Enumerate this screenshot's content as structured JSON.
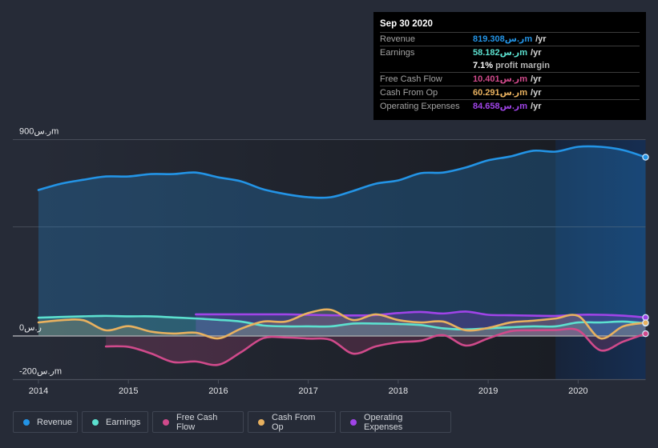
{
  "tooltip": {
    "date": "Sep 30 2020",
    "rows": [
      {
        "label": "Revenue",
        "value": "ر.س819.308m",
        "suffix": "/yr",
        "color": "#2394e6"
      },
      {
        "label": "Earnings",
        "value": "ر.س58.182m",
        "suffix": "/yr",
        "color": "#5ce0cf"
      },
      {
        "label": "Free Cash Flow",
        "value": "ر.س10.401m",
        "suffix": "/yr",
        "color": "#d04a8b"
      },
      {
        "label": "Cash From Op",
        "value": "ر.س60.291m",
        "suffix": "/yr",
        "color": "#e8b15f"
      },
      {
        "label": "Operating Expenses",
        "value": "ر.س84.658m",
        "suffix": "/yr",
        "color": "#a044e8"
      }
    ],
    "profit_margin": {
      "value": "7.1%",
      "label": "profit margin"
    }
  },
  "legend": {
    "items": [
      {
        "label": "Revenue",
        "color": "#2394e6"
      },
      {
        "label": "Earnings",
        "color": "#5ce0cf"
      },
      {
        "label": "Free Cash Flow",
        "color": "#d04a8b"
      },
      {
        "label": "Cash From Op",
        "color": "#e8b15f"
      },
      {
        "label": "Operating Expenses",
        "color": "#a044e8"
      }
    ]
  },
  "chart_data": {
    "type": "area",
    "title": "",
    "xlabel": "",
    "ylabel": "",
    "xlim": [
      2014,
      2020.75
    ],
    "ylim": [
      -200,
      900
    ],
    "grid": true,
    "y_gridlines": [
      900,
      500
    ],
    "y_tick_labels": [
      {
        "value": 900,
        "label": "ر.س900m"
      },
      {
        "value": 0,
        "label": "ر.س0"
      },
      {
        "value": -200,
        "label": "-ر.س200m"
      }
    ],
    "x_ticks": [
      2014,
      2015,
      2016,
      2017,
      2018,
      2019,
      2020
    ],
    "x_tick_labels": [
      "2014",
      "2015",
      "2016",
      "2017",
      "2018",
      "2019",
      "2020"
    ],
    "highlight_range": [
      2019.75,
      2020.75
    ],
    "legend_position": "bottom-left",
    "x": [
      2014.0,
      2014.25,
      2014.5,
      2014.75,
      2015.0,
      2015.25,
      2015.5,
      2015.75,
      2016.0,
      2016.25,
      2016.5,
      2016.75,
      2017.0,
      2017.25,
      2017.5,
      2017.75,
      2018.0,
      2018.25,
      2018.5,
      2018.75,
      2019.0,
      2019.25,
      2019.5,
      2019.75,
      2020.0,
      2020.25,
      2020.5,
      2020.75
    ],
    "series": [
      {
        "name": "Revenue",
        "color": "#2394e6",
        "fill_opacity": 0.25,
        "values": [
          669,
          698,
          716,
          731,
          731,
          742,
          742,
          749,
          727,
          709,
          672,
          650,
          636,
          636,
          665,
          698,
          713,
          746,
          749,
          772,
          805,
          823,
          849,
          845,
          867,
          867,
          852,
          819.3
        ]
      },
      {
        "name": "Operating Expenses",
        "color": "#a044e8",
        "fill_opacity": 0.22,
        "values": [
          null,
          null,
          null,
          null,
          null,
          null,
          null,
          99,
          99,
          99,
          99,
          99,
          97,
          95,
          94,
          96,
          105,
          110,
          103,
          112,
          97,
          95,
          93,
          92,
          97,
          97,
          93,
          84.7
        ]
      },
      {
        "name": "Earnings",
        "color": "#5ce0cf",
        "fill_opacity": 0.18,
        "values": [
          84,
          87,
          90,
          92,
          90,
          90,
          85,
          80,
          74,
          66,
          48,
          44,
          44,
          44,
          57,
          57,
          55,
          50,
          35,
          30,
          35,
          40,
          44,
          44,
          62,
          62,
          66,
          58.2
        ]
      },
      {
        "name": "Cash From Op",
        "color": "#e8b15f",
        "fill_opacity": 0.18,
        "values": [
          62,
          72,
          72,
          26,
          45,
          20,
          11,
          15,
          -11,
          33,
          66,
          66,
          105,
          120,
          73,
          99,
          73,
          62,
          66,
          26,
          37,
          62,
          70,
          80,
          92,
          -11,
          44,
          60.3
        ]
      },
      {
        "name": "Free Cash Flow",
        "color": "#d04a8b",
        "fill_opacity": 0.2,
        "values": [
          null,
          null,
          null,
          -48,
          -50,
          -80,
          -120,
          -117,
          -132,
          -75,
          -10,
          -7,
          -12,
          -18,
          -81,
          -48,
          -29,
          -22,
          4,
          -44,
          -11,
          22,
          26,
          27,
          26,
          -66,
          -26,
          10.4
        ]
      }
    ]
  }
}
